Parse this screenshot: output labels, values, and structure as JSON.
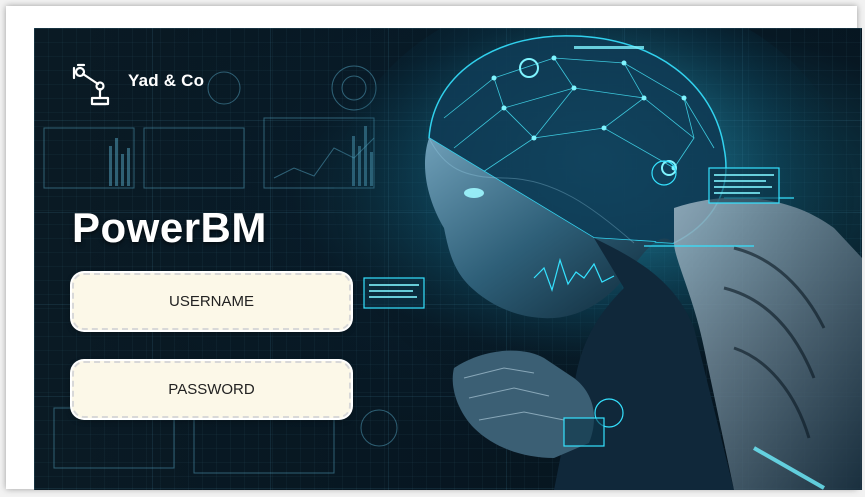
{
  "brand": {
    "name": "Yad & Co",
    "logo_icon": "robot-arm-icon"
  },
  "app": {
    "title": "PowerBM"
  },
  "login": {
    "username_placeholder": "USERNAME",
    "password_placeholder": "PASSWORD"
  },
  "colors": {
    "background": "#071722",
    "accent": "#2ee6ff",
    "field_bg": "#fcf8e8",
    "title": "#ffffff"
  }
}
